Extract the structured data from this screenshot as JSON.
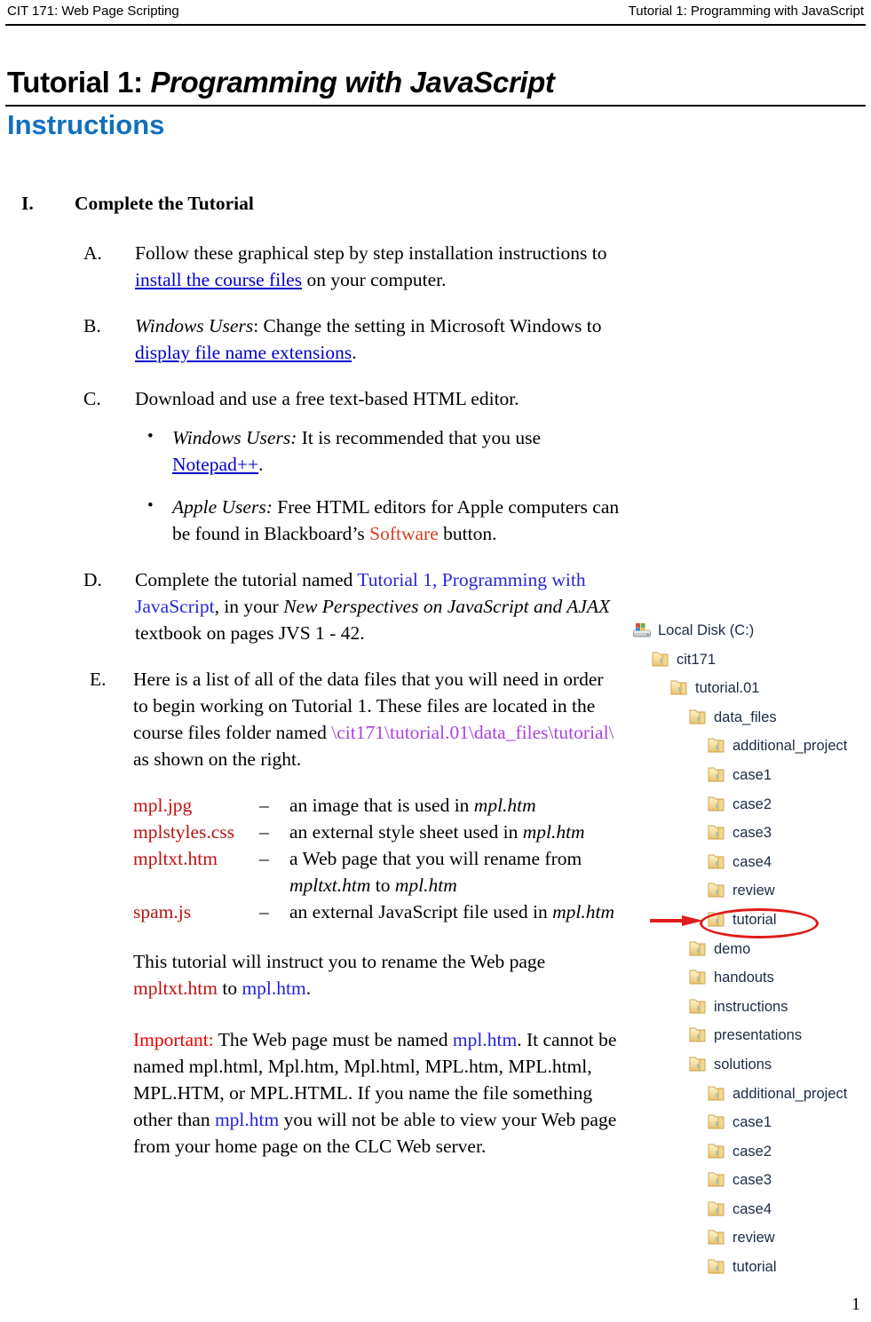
{
  "header": {
    "left": "CIT 171: Web Page Scripting",
    "right": "Tutorial 1: Programming with JavaScript"
  },
  "title": {
    "prefix": "Tutorial 1: ",
    "italic": "Programming with JavaScript",
    "subtitle": "Instructions"
  },
  "colors": {
    "subtitle_blue": "#1270BE",
    "link_blue": "#0000CC",
    "text_blue": "#2727D6",
    "file_red": "#BB1111",
    "important_red": "#EE0000",
    "software_orange": "#D2401E",
    "path_purple": "#AA44DD",
    "annotation_red": "#E01B1B",
    "tree_text": "#1B2B45",
    "folder_yellow": "#F5D98B"
  },
  "outline": {
    "section_marker": "I.",
    "section_title": "Complete the Tutorial",
    "items": [
      {
        "marker": "A.",
        "text_before": "Follow these graphical step by step installation instructions to",
        "link": "install the course files",
        "text_after": " on your computer."
      },
      {
        "marker": "B.",
        "italic_lead": "Windows Users",
        "text_before": ": Change the setting in Microsoft Windows to",
        "link": "display  file name extensions",
        "text_after": "."
      },
      {
        "marker": "C.",
        "text": "Download and use a free text-based HTML editor.",
        "bullets": [
          {
            "bullet": "•",
            "italic_lead": "Windows Users:",
            "text_before": " It is recommended that you use ",
            "link": "Notepad++",
            "text_after": "."
          },
          {
            "bullet": "•",
            "italic_lead": "Apple Users:",
            "text_before": " Free HTML editors for Apple computers can be found in Blackboard’s ",
            "highlight": "Software",
            "text_after": " button."
          }
        ]
      },
      {
        "marker": "D.",
        "text_before": "Complete the tutorial named ",
        "blue1": "Tutorial 1",
        "mid": ", ",
        "blue2": "Programming with JavaScript",
        "text_after": ", in your ",
        "italic_book": "New Perspectives on JavaScript and AJAX",
        "text_tail": " textbook on pages JVS 1 - 42."
      },
      {
        "marker": "E.",
        "intro_before": "Here is a list of all of the data files that you will need in order to begin working on Tutorial 1. These files are located in the course files folder named ",
        "path": "\\cit171\\tutorial.01\\data_files\\tutorial\\",
        "intro_after": " as shown on the right."
      }
    ]
  },
  "files": {
    "dash": "–",
    "rows": [
      {
        "name": "mpl.jpg",
        "desc_before": "an image that is used in ",
        "desc_italic": "mpl.htm",
        "desc_after": ""
      },
      {
        "name": "mplstyles.css",
        "desc_before": "an external style sheet used in ",
        "desc_italic": "mpl.htm",
        "desc_after": ""
      },
      {
        "name": "mpltxt.htm",
        "desc_before": "a Web page that you will rename from ",
        "desc_italic": "mpltxt.htm",
        "desc_mid": " to ",
        "desc_italic2": "mpl.htm",
        "desc_after": ""
      },
      {
        "name": "spam.js",
        "desc_before": "an external JavaScript file used in ",
        "desc_italic": "mpl.htm",
        "desc_after": ""
      }
    ]
  },
  "rename_para": {
    "before": "This tutorial will instruct you to rename the Web page ",
    "old_name": "mpltxt.htm",
    "mid": " to ",
    "new_name": "mpl.htm",
    "after": "."
  },
  "important_para": {
    "label": "Important:",
    "part1": " The Web page must be named ",
    "name1": "mpl.htm",
    "part2": ". It cannot be named mpl.html, Mpl.htm, Mpl.html, MPL.htm, MPL.html, MPL.HTM, or MPL.HTML. If you name the file something other than ",
    "name2": "mpl.htm",
    "part3": " you will not be able to view your Web page from your home page on the CLC Web server."
  },
  "tree": {
    "rows": [
      {
        "label": "Local Disk (C:)",
        "depth": 0,
        "icon": "drive-icon"
      },
      {
        "label": "cit171",
        "depth": 1,
        "icon": "folder-icon"
      },
      {
        "label": "tutorial.01",
        "depth": 2,
        "icon": "folder-icon"
      },
      {
        "label": "data_files",
        "depth": 3,
        "icon": "folder-icon"
      },
      {
        "label": "additional_project",
        "depth": 4,
        "icon": "folder-icon"
      },
      {
        "label": "case1",
        "depth": 4,
        "icon": "folder-icon"
      },
      {
        "label": "case2",
        "depth": 4,
        "icon": "folder-icon"
      },
      {
        "label": "case3",
        "depth": 4,
        "icon": "folder-icon"
      },
      {
        "label": "case4",
        "depth": 4,
        "icon": "folder-icon"
      },
      {
        "label": "review",
        "depth": 4,
        "icon": "folder-icon"
      },
      {
        "label": "tutorial",
        "depth": 4,
        "icon": "folder-icon",
        "highlighted": true
      },
      {
        "label": "demo",
        "depth": 3,
        "icon": "folder-icon"
      },
      {
        "label": "handouts",
        "depth": 3,
        "icon": "folder-icon"
      },
      {
        "label": "instructions",
        "depth": 3,
        "icon": "folder-icon"
      },
      {
        "label": "presentations",
        "depth": 3,
        "icon": "folder-icon"
      },
      {
        "label": "solutions",
        "depth": 3,
        "icon": "folder-icon"
      },
      {
        "label": "additional_project",
        "depth": 4,
        "icon": "folder-icon"
      },
      {
        "label": "case1",
        "depth": 4,
        "icon": "folder-icon"
      },
      {
        "label": "case2",
        "depth": 4,
        "icon": "folder-icon"
      },
      {
        "label": "case3",
        "depth": 4,
        "icon": "folder-icon"
      },
      {
        "label": "case4",
        "depth": 4,
        "icon": "folder-icon"
      },
      {
        "label": "review",
        "depth": 4,
        "icon": "folder-icon"
      },
      {
        "label": "tutorial",
        "depth": 4,
        "icon": "folder-icon"
      }
    ]
  },
  "page_number": "1"
}
